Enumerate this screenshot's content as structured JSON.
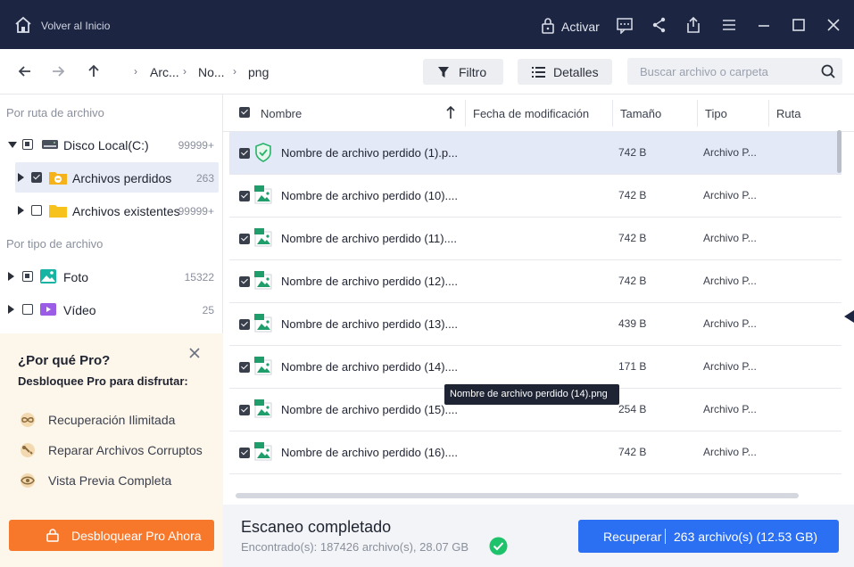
{
  "titlebar": {
    "home_label": "Volver al Inicio",
    "activate_label": "Activar",
    "icons": [
      "home-icon",
      "lock-icon",
      "feedback-icon",
      "share-icon",
      "export-icon",
      "menu-icon",
      "minimize-icon",
      "maximize-icon",
      "close-icon"
    ]
  },
  "navbar": {
    "breadcrumb": [
      "Arc...",
      "No...",
      "png"
    ],
    "filter_label": "Filtro",
    "details_label": "Detalles",
    "search_placeholder": "Buscar archivo o carpeta"
  },
  "sidebar": {
    "by_path_heading": "Por ruta de archivo",
    "by_type_heading": "Por tipo de archivo",
    "tree": [
      {
        "label": "Disco Local(C:)",
        "count": "99999+",
        "icon": "drive-icon",
        "expanded": true,
        "check": "partial"
      },
      {
        "label": "Archivos perdidos",
        "count": "263",
        "icon": "folder-lost-icon",
        "expanded": false,
        "check": "checked",
        "selected": true
      },
      {
        "label": "Archivos existentes",
        "count": "99999+",
        "icon": "folder-icon",
        "expanded": false,
        "check": "unchecked"
      }
    ],
    "types": [
      {
        "label": "Foto",
        "count": "15322",
        "icon": "photo-icon",
        "check": "partial"
      },
      {
        "label": "Vídeo",
        "count": "25",
        "icon": "video-icon",
        "check": "unchecked"
      }
    ]
  },
  "pro": {
    "title": "¿Por qué Pro?",
    "subtitle": "Desbloquee Pro para disfrutar:",
    "items": [
      {
        "label": "Recuperación Ilimitada",
        "icon": "infinity-icon"
      },
      {
        "label": "Reparar Archivos Corruptos",
        "icon": "wrench-icon"
      },
      {
        "label": "Vista Previa Completa",
        "icon": "eye-icon"
      }
    ],
    "button_label": "Desbloquear Pro Ahora"
  },
  "table": {
    "columns": {
      "name": "Nombre",
      "modified": "Fecha de modificación",
      "size": "Tamaño",
      "type": "Tipo",
      "path": "Ruta"
    },
    "rows": [
      {
        "name": "Nombre de archivo perdido (1).p...",
        "size": "742 B",
        "type": "Archivo P...",
        "icon": "shield-check-icon",
        "selected": true
      },
      {
        "name": "Nombre de archivo perdido (10)....",
        "size": "742 B",
        "type": "Archivo P...",
        "icon": "png-file-icon"
      },
      {
        "name": "Nombre de archivo perdido (11)....",
        "size": "742 B",
        "type": "Archivo P...",
        "icon": "png-file-icon"
      },
      {
        "name": "Nombre de archivo perdido (12)....",
        "size": "742 B",
        "type": "Archivo P...",
        "icon": "png-file-icon"
      },
      {
        "name": "Nombre de archivo perdido (13)....",
        "size": "439 B",
        "type": "Archivo P...",
        "icon": "png-file-icon"
      },
      {
        "name": "Nombre de archivo perdido (14)....",
        "size": "171 B",
        "type": "Archivo P...",
        "icon": "png-file-icon"
      },
      {
        "name": "Nombre de archivo perdido (15)....",
        "size": "254 B",
        "type": "Archivo P...",
        "icon": "png-file-icon"
      },
      {
        "name": "Nombre de archivo perdido (16)....",
        "size": "742 B",
        "type": "Archivo P...",
        "icon": "png-file-icon"
      }
    ],
    "tooltip": "Nombre de archivo perdido (14).png"
  },
  "footer": {
    "status_title": "Escaneo completado",
    "found_text": "Encontrado(s): 187426 archivo(s), 28.07 GB",
    "recover_label": "Recuperar",
    "recover_count": "263 archivo(s) (12.53 GB)"
  },
  "colors": {
    "titlebar_bg": "#1c2541",
    "accent_blue": "#2b6ff2",
    "pro_orange": "#f7782b",
    "success_green": "#1ec26a"
  }
}
